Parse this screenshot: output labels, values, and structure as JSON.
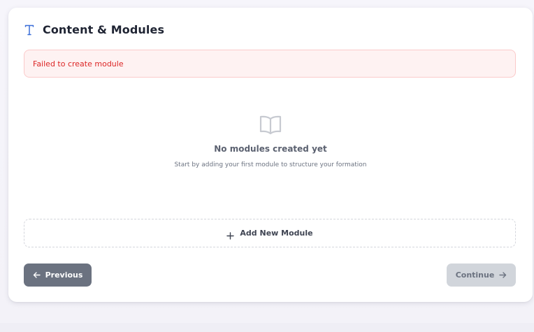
{
  "section": {
    "title": "Content & Modules",
    "title_icon": "type-icon"
  },
  "alert": {
    "message": "Failed to create module"
  },
  "empty_state": {
    "icon": "book-open-icon",
    "title": "No modules created yet",
    "description": "Start by adding your first module to structure your formation"
  },
  "actions": {
    "add_module_label": "Add New Module",
    "previous_label": "Previous",
    "continue_label": "Continue"
  },
  "colors": {
    "accent": "#3b6fd8",
    "error_text": "#dc2626",
    "error_bg": "#fef2f2",
    "previous_bg": "#6b7280",
    "continue_bg_disabled": "#d1d5db"
  }
}
